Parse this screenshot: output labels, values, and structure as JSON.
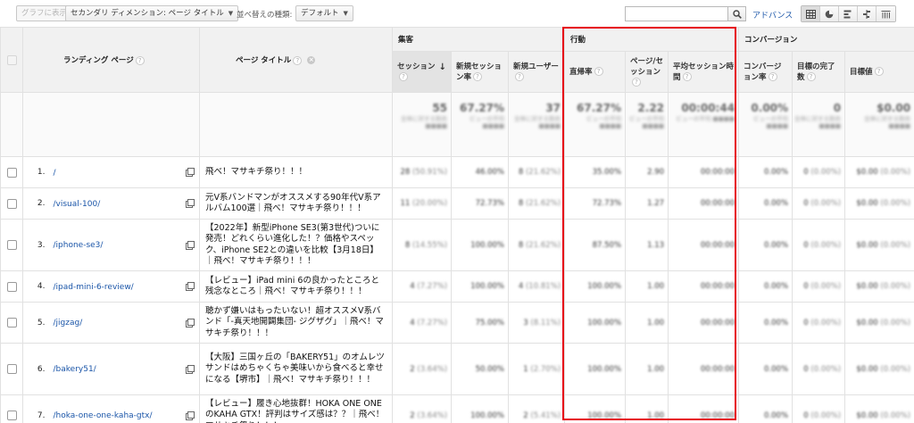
{
  "toolbar": {
    "chart_btn": "グラフに表示",
    "secondary_dim": "セカンダリ ディメンション: ページ タイトル",
    "sort_label": "並べ替えの種類:",
    "sort_value": "デフォルト",
    "search_placeholder": "",
    "advanced": "アドバンス"
  },
  "groups": {
    "acquisition": "集客",
    "behavior": "行動",
    "conversion": "コンバージョン"
  },
  "columns": {
    "landing_page": "ランディング ページ",
    "page_title": "ページ タイトル",
    "sessions": "セッション",
    "new_session_rate": "新規セッション率",
    "new_users": "新規ユーザー",
    "bounce_rate": "直帰率",
    "pages_per_session": "ページ/セッション",
    "avg_session_duration": "平均セッション時間",
    "conversion_rate": "コンバージョン率",
    "goal_completions": "目標の完了数",
    "goal_value": "目標値"
  },
  "totals": {
    "sessions": "55",
    "new_session_rate": "67.27%",
    "new_users": "37",
    "bounce_rate": "67.27%",
    "pages_per_session": "2.22",
    "avg_session_duration": "00:00:44",
    "conversion_rate": "0.00%",
    "goal_completions": "0",
    "goal_value": "$0.00",
    "sub_sessions": "全体に対する割合 ■■■■",
    "sub_new_session_rate": "ビューの平均 ■■■■",
    "sub_new_users": "全体に対する割合 ■■■■",
    "sub_bounce_rate": "ビューの平均 ■■■■",
    "sub_pages_per_session": "ビューの平均 ■■■■",
    "sub_avg_session_duration": "ビューの平均 ■■■■",
    "sub_conversion_rate": "ビューの平均 ■■■■",
    "sub_goal_completions": "全体に対する割合 ■■■■",
    "sub_goal_value": "全体に対する割合 ■■■■"
  },
  "rows": [
    {
      "idx": "1.",
      "landing": "/",
      "title": "飛べ！マサキチ祭り！！！",
      "sessions": "28",
      "sessions_pct": "(50.91%)",
      "nsr": "46.00%",
      "nu": "8",
      "nu_pct": "(21.62%)",
      "br": "35.00%",
      "pps": "2.90",
      "asd": "00:00:00",
      "cr": "0.00%",
      "gc": "0",
      "gc_pct": "(0.00%)",
      "gv": "$0.00",
      "gv_pct": "(0.00%)"
    },
    {
      "idx": "2.",
      "landing": "/visual-100/",
      "title": "元V系バンドマンがオススメする90年代V系アルバム100選｜飛べ！マサキチ祭り！！！",
      "sessions": "11",
      "sessions_pct": "(20.00%)",
      "nsr": "72.73%",
      "nu": "8",
      "nu_pct": "(21.62%)",
      "br": "72.73%",
      "pps": "1.27",
      "asd": "00:00:00",
      "cr": "0.00%",
      "gc": "0",
      "gc_pct": "(0.00%)",
      "gv": "$0.00",
      "gv_pct": "(0.00%)"
    },
    {
      "idx": "3.",
      "landing": "/iphone-se3/",
      "title": "【2022年】新型iPhone SE3(第3世代)ついに発売！どれくらい進化した！？価格やスペック、iPhone SE2との違いを比較【3月18日】｜飛べ！マサキチ祭り！！！",
      "sessions": "8",
      "sessions_pct": "(14.55%)",
      "nsr": "100.00%",
      "nu": "8",
      "nu_pct": "(21.62%)",
      "br": "87.50%",
      "pps": "1.13",
      "asd": "00:00:00",
      "cr": "0.00%",
      "gc": "0",
      "gc_pct": "(0.00%)",
      "gv": "$0.00",
      "gv_pct": "(0.00%)"
    },
    {
      "idx": "4.",
      "landing": "/ipad-mini-6-review/",
      "title": "【レビュー】iPad mini 6の良かったところと残念なところ｜飛べ！マサキチ祭り！！！",
      "sessions": "4",
      "sessions_pct": "(7.27%)",
      "nsr": "100.00%",
      "nu": "4",
      "nu_pct": "(10.81%)",
      "br": "100.00%",
      "pps": "1.00",
      "asd": "00:00:00",
      "cr": "0.00%",
      "gc": "0",
      "gc_pct": "(0.00%)",
      "gv": "$0.00",
      "gv_pct": "(0.00%)"
    },
    {
      "idx": "5.",
      "landing": "/jigzag/",
      "title": "聴かず嫌いはもったいない！超オススメV系バンド「-真天地開闢集団- ジグザグ」｜飛べ！マサキチ祭り！！！",
      "sessions": "4",
      "sessions_pct": "(7.27%)",
      "nsr": "75.00%",
      "nu": "3",
      "nu_pct": "(8.11%)",
      "br": "100.00%",
      "pps": "1.00",
      "asd": "00:00:00",
      "cr": "0.00%",
      "gc": "0",
      "gc_pct": "(0.00%)",
      "gv": "$0.00",
      "gv_pct": "(0.00%)"
    },
    {
      "idx": "6.",
      "landing": "/bakery51/",
      "title": "【大阪】三国ヶ丘の「BAKERY51」のオムレツサンドはめちゃくちゃ美味いから食べると幸せになる【堺市】｜飛べ！マサキチ祭り！！！",
      "sessions": "2",
      "sessions_pct": "(3.64%)",
      "nsr": "50.00%",
      "nu": "1",
      "nu_pct": "(2.70%)",
      "br": "100.00%",
      "pps": "1.00",
      "asd": "00:00:00",
      "cr": "0.00%",
      "gc": "0",
      "gc_pct": "(0.00%)",
      "gv": "$0.00",
      "gv_pct": "(0.00%)"
    },
    {
      "idx": "7.",
      "landing": "/hoka-one-one-kaha-gtx/",
      "title": "【レビュー】履き心地抜群！HOKA ONE ONEのKAHA GTX！評判はサイズ感は？？｜飛べ！マサキチ祭り！！！",
      "sessions": "2",
      "sessions_pct": "(3.64%)",
      "nsr": "100.00%",
      "nu": "2",
      "nu_pct": "(5.41%)",
      "br": "100.00%",
      "pps": "1.00",
      "asd": "00:00:00",
      "cr": "0.00%",
      "gc": "0",
      "gc_pct": "(0.00%)",
      "gv": "$0.00",
      "gv_pct": "(0.00%)"
    }
  ],
  "colors": {
    "highlight": "#e60012",
    "link": "#1a55a8"
  },
  "icons": {
    "search": "search-icon",
    "open_link": "open-link-icon",
    "help": "help-icon",
    "remove": "remove-icon"
  }
}
